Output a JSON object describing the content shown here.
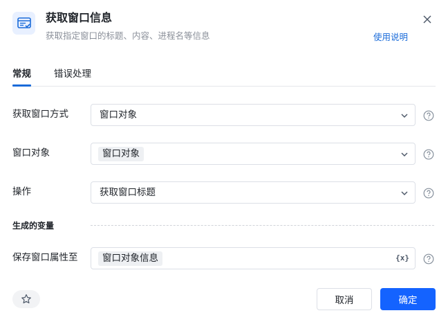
{
  "header": {
    "icon": "window-info-icon",
    "title": "获取窗口信息",
    "subtitle": "获取指定窗口的标题、内容、进程名等信息",
    "help_link": "使用说明",
    "accent_color": "#1463ff"
  },
  "tabs": [
    {
      "label": "常规",
      "active": true
    },
    {
      "label": "错误处理",
      "active": false
    }
  ],
  "form": {
    "method": {
      "label": "获取窗口方式",
      "value": "窗口对象"
    },
    "window_object": {
      "label": "窗口对象",
      "value": "窗口对象"
    },
    "operation": {
      "label": "操作",
      "value": "获取窗口标题"
    }
  },
  "generated_variables": {
    "section_label": "生成的变量",
    "save_to": {
      "label": "保存窗口属性至",
      "value": "窗口对象信息",
      "var_button": "{x}"
    }
  },
  "footer": {
    "cancel_label": "取消",
    "ok_label": "确定"
  }
}
